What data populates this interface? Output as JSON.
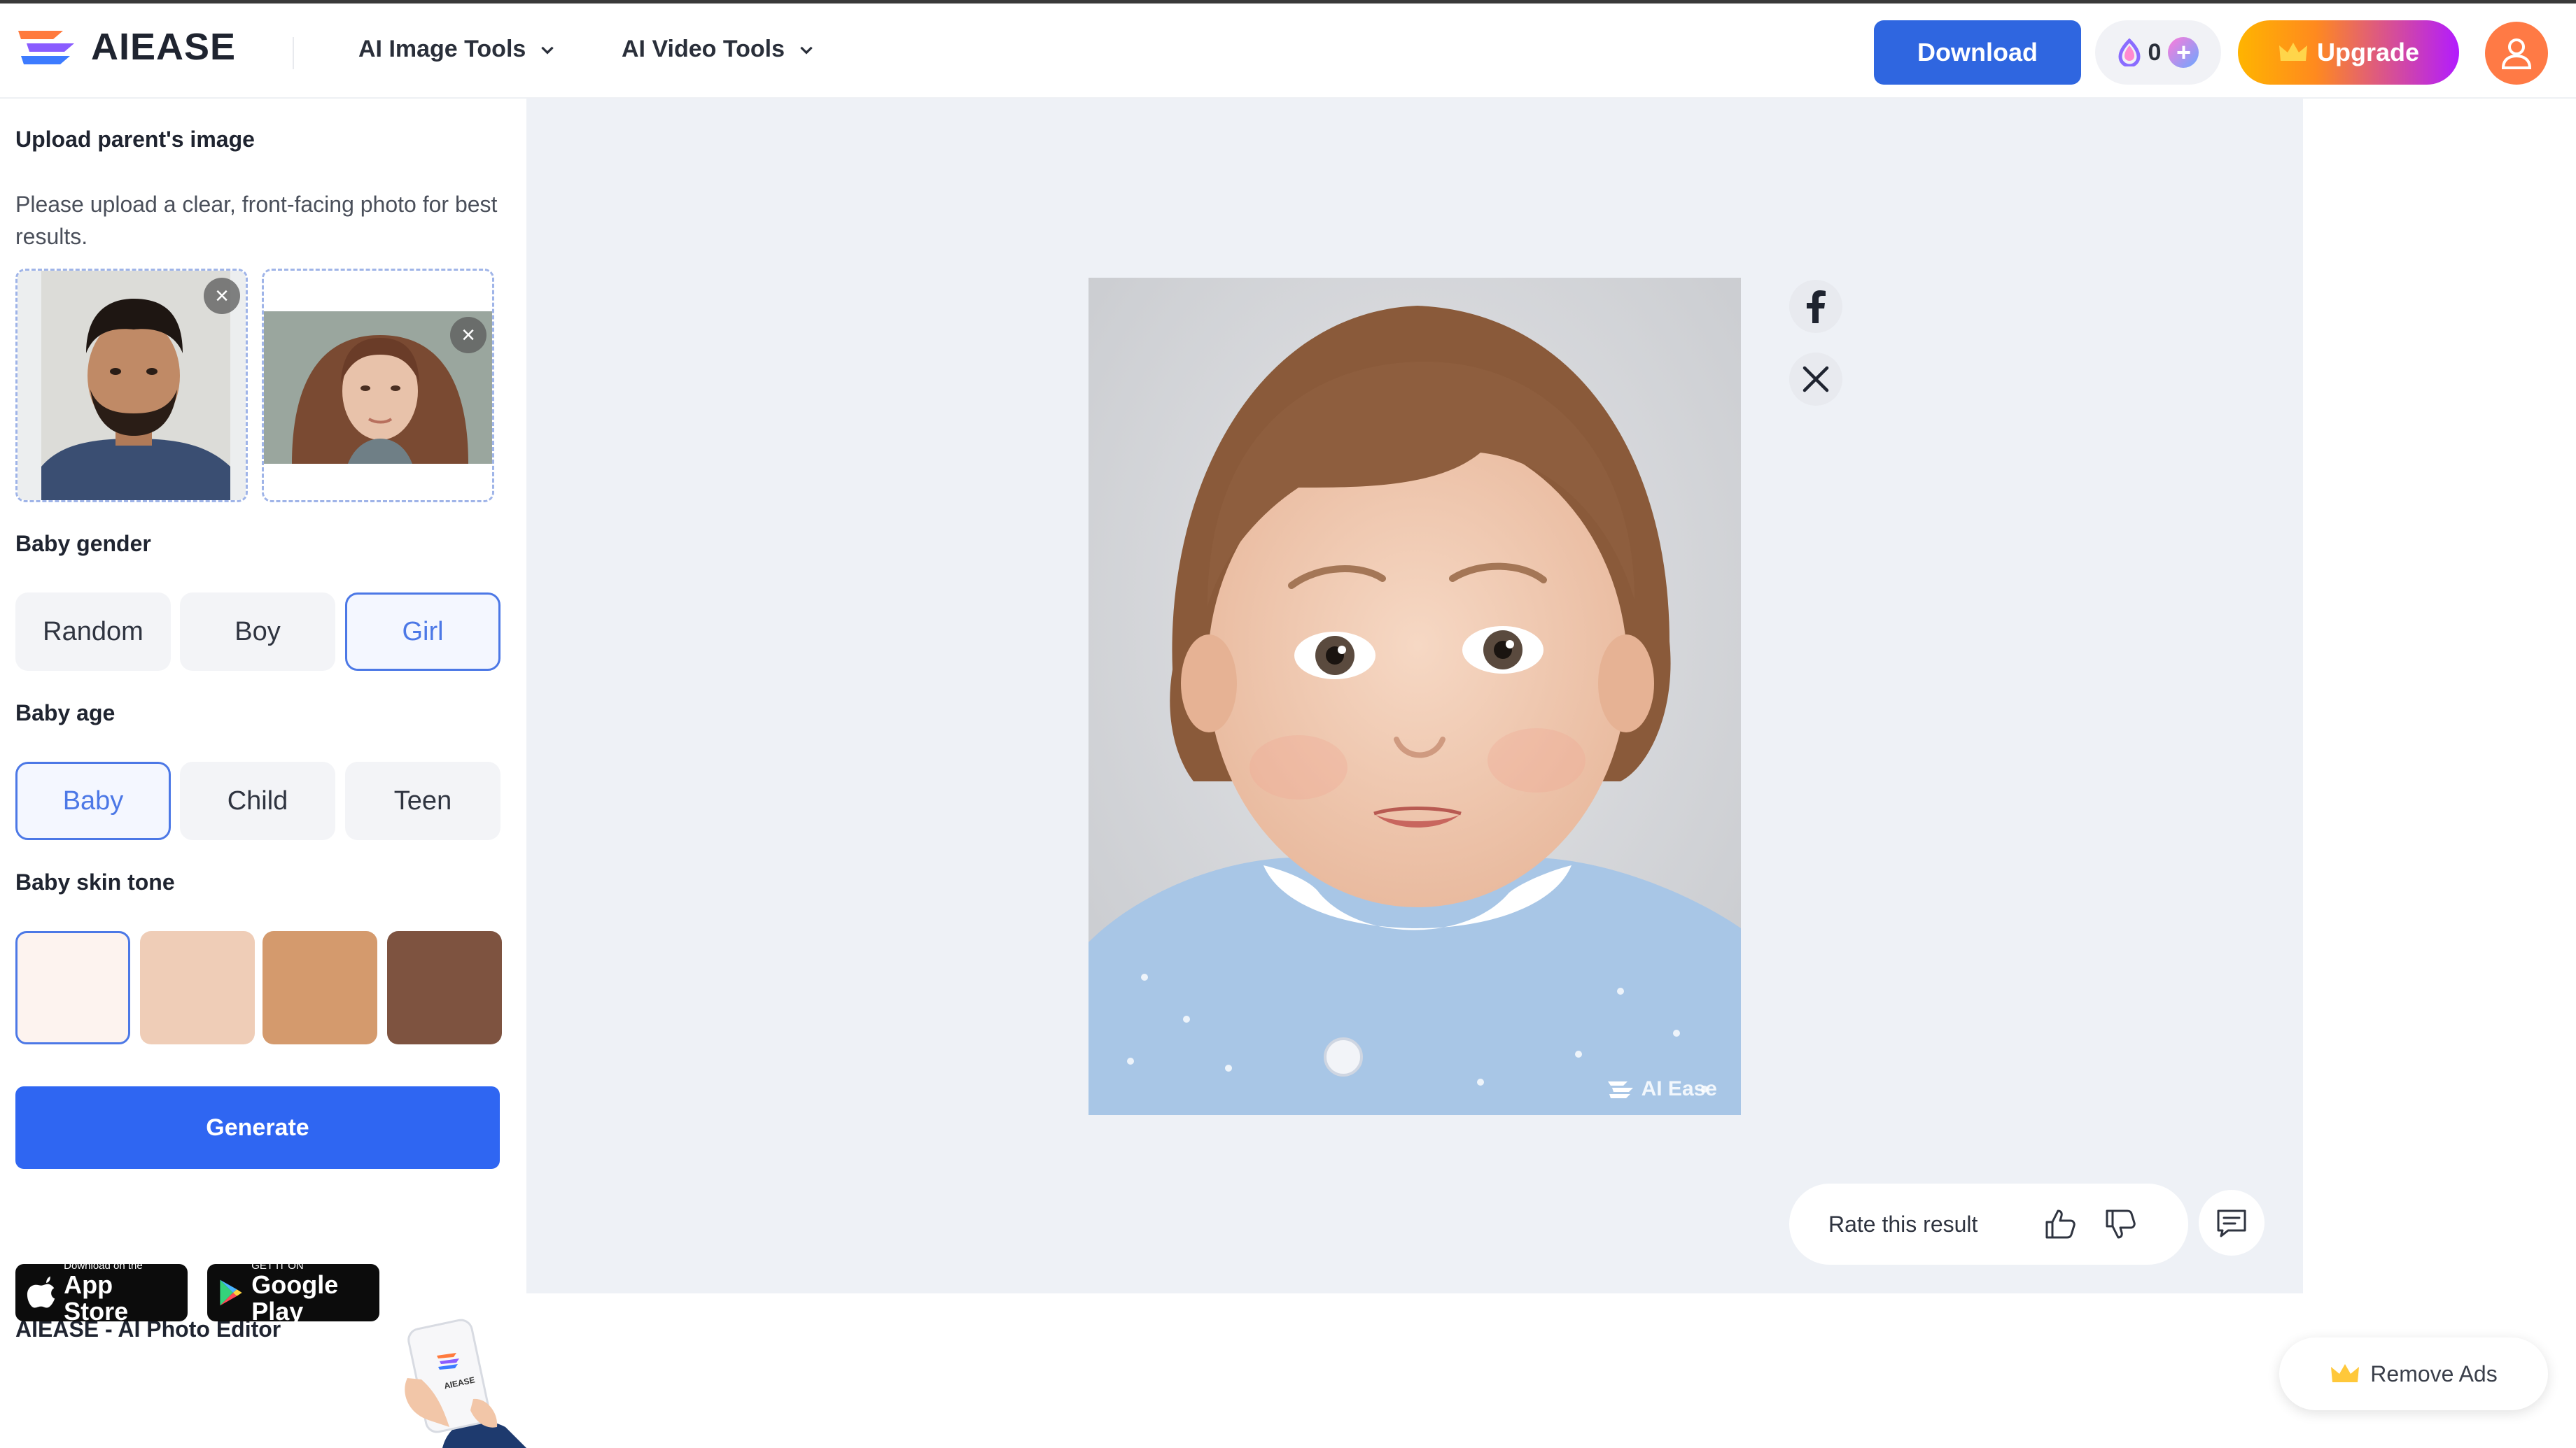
{
  "header": {
    "logo_text": "AIEASE",
    "nav": [
      {
        "label": "AI Image Tools"
      },
      {
        "label": "AI Video Tools"
      }
    ],
    "download_label": "Download",
    "credits": "0",
    "upgrade_label": "Upgrade"
  },
  "sidebar": {
    "upload_title": "Upload parent's image",
    "upload_desc": "Please upload a clear, front-facing photo for best results.",
    "gender_title": "Baby gender",
    "gender_options": [
      "Random",
      "Boy",
      "Girl"
    ],
    "gender_selected": "Girl",
    "age_title": "Baby age",
    "age_options": [
      "Baby",
      "Child",
      "Teen"
    ],
    "age_selected": "Baby",
    "skin_title": "Baby skin tone",
    "skin_tones": [
      "#fdf3ef",
      "#efcdb7",
      "#d49a6d",
      "#7e5340"
    ],
    "skin_selected_index": 0,
    "generate_label": "Generate",
    "footer_title": "AIEASE - AI Photo Editor",
    "app_store": {
      "small": "Download on the",
      "big": "App Store"
    },
    "google_play": {
      "small": "GET IT ON",
      "big": "Google Play"
    },
    "promo_phone_text": "AIEASE"
  },
  "main": {
    "watermark": "AI Ease",
    "rate_label": "Rate this result"
  },
  "remove_ads_label": "Remove Ads",
  "colors": {
    "primary": "#2f66e0",
    "selected": "#4c78e6",
    "canvas_bg": "#eef1f6"
  }
}
